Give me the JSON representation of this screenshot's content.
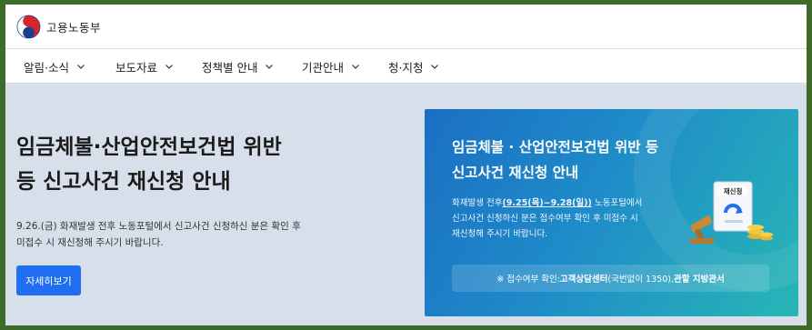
{
  "header": {
    "logo_text": "고용노동부",
    "logo_icon": "taegeuk-logo"
  },
  "nav": {
    "items": [
      {
        "label": "알림·소식"
      },
      {
        "label": "보도자료"
      },
      {
        "label": "정책별 안내"
      },
      {
        "label": "기관안내"
      },
      {
        "label": "청·지청"
      }
    ]
  },
  "hero": {
    "title_line1": "임금체불·산업안전보건법 위반",
    "title_line2": "등 신고사건 재신청 안내",
    "desc_line1": "9.26.(금) 화재발생 전후 노동포털에서 신고사건 신청하신 분은 확인 후",
    "desc_line2": "미접수 시 재신청해 주시기 바랍니다.",
    "button_label": "자세히보기"
  },
  "card": {
    "title_line1": "임금체불 · 산업안전보건법 위반 등",
    "title_line2": "신고사건 재신청 안내",
    "desc_pre": "화재발생 전후",
    "desc_highlight": "(9.25(목)~9.28(일))",
    "desc_post": " 노동포털에서",
    "desc_line2": "신고사건 신청하신 분은 접수여부 확인 후 미접수 시",
    "desc_line3": "재신청해 주시기 바랍니다.",
    "note_prefix": "※ 접수여부 확인: ",
    "note_center": "고객상담센터",
    "note_phone": "(국번없이 1350), ",
    "note_office": "관할 지방관서",
    "illus_badge": "재신청",
    "colors": {
      "start": "#1a6fc3",
      "end": "#27b7b5"
    }
  },
  "colors": {
    "button": "#1f6ff0",
    "hero_bg": "#d7e0ea"
  }
}
